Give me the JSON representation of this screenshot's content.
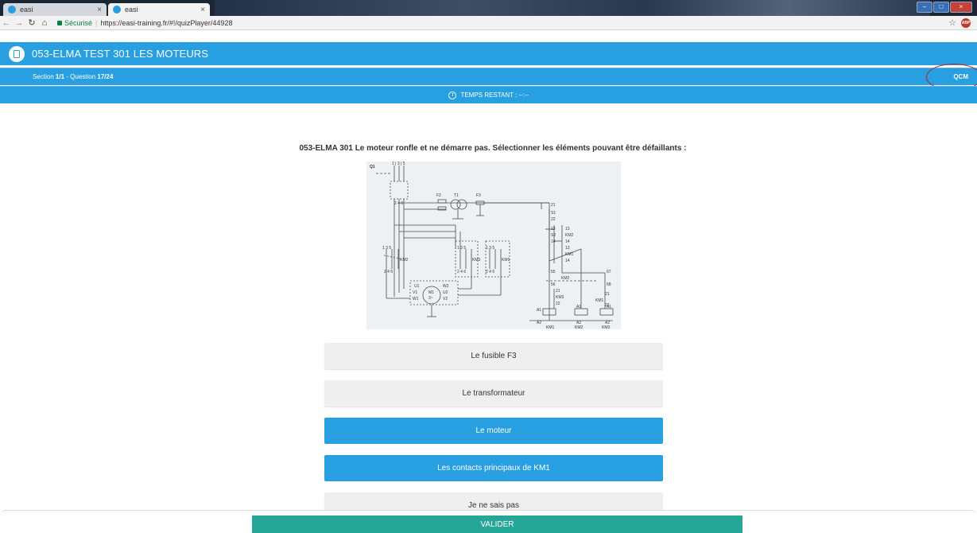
{
  "browser": {
    "tabs": [
      {
        "label": "easi",
        "active": false
      },
      {
        "label": "easi",
        "active": true
      }
    ],
    "secure_label": "Sécurisé",
    "url": "https://easi-training.fr/#!/quizPlayer/44928",
    "abp_label": "ABP"
  },
  "header": {
    "title": "053-ELMA TEST 301 LES MOTEURS",
    "section_label": "Section ",
    "section_value": "1/1",
    "question_label": " - Question ",
    "question_value": "17/24",
    "mode": "QCM",
    "timer": "TEMPS RESTANT : --:--"
  },
  "question": {
    "text": "053-ELMA 301 Le moteur ronfle et ne démarre pas. Sélectionner les éléments pouvant être défaillants :"
  },
  "diagram": {
    "labels": [
      "Q1",
      "1",
      "3",
      "5",
      "2",
      "4",
      "6",
      "F2",
      "T1",
      "F3",
      "KM2",
      "KM3",
      "KM1",
      "U1",
      "V1",
      "W1",
      "W2",
      "U2",
      "V2",
      "M1",
      "3~",
      "21",
      "S1",
      "22",
      "13",
      "S2",
      "14",
      "KM2",
      "KM1",
      "55",
      "56",
      "67",
      "68",
      "KM1",
      "KM3",
      "A1",
      "A2",
      "KM1",
      "KM2",
      "KM3"
    ]
  },
  "answers": [
    {
      "label": "Le fusible F3",
      "selected": false
    },
    {
      "label": "Le transformateur",
      "selected": false
    },
    {
      "label": "Le moteur",
      "selected": true
    },
    {
      "label": "Les contacts principaux de KM1",
      "selected": true
    },
    {
      "label": "Je ne sais pas",
      "selected": false
    }
  ],
  "footer": {
    "submit_label": "VALIDER"
  },
  "colors": {
    "primary": "#279fe0",
    "submit": "#25a697",
    "annotation": "#b3202b"
  }
}
